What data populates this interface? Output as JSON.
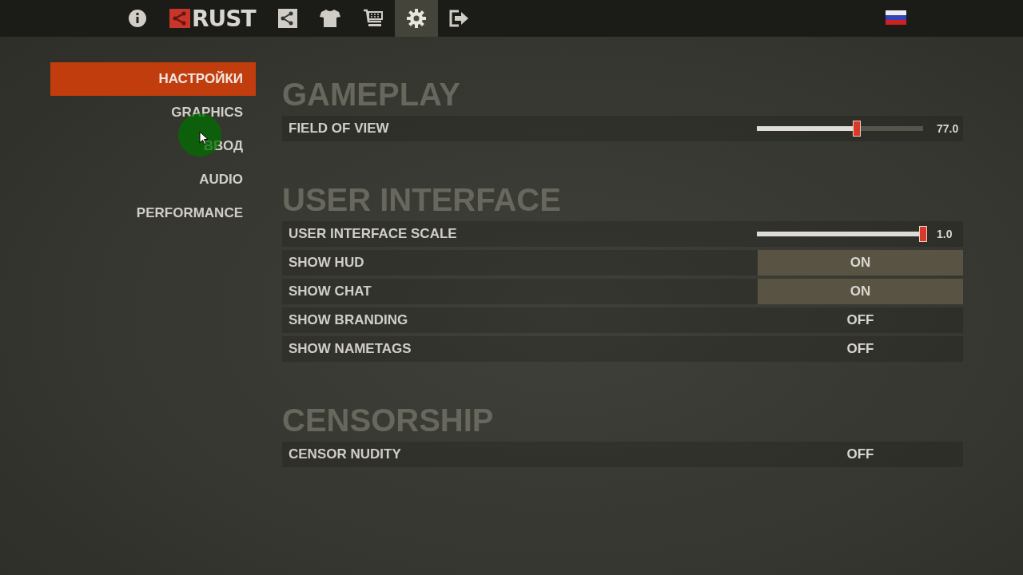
{
  "topbar": {
    "logo": {
      "text": "RUST"
    },
    "tabs": [
      {
        "kind": "info",
        "selected": false
      },
      {
        "kind": "logo",
        "selected": false
      },
      {
        "kind": "nodes",
        "selected": false
      },
      {
        "kind": "shirt",
        "selected": false
      },
      {
        "kind": "cart",
        "selected": false
      },
      {
        "kind": "gear",
        "selected": true
      },
      {
        "kind": "exit",
        "selected": false
      }
    ],
    "language": {
      "kind": "flag-ru"
    }
  },
  "sidebar": {
    "items": [
      {
        "label": "НАСТРОЙКИ",
        "selected": true
      },
      {
        "label": "GRAPHICS",
        "selected": false
      },
      {
        "label": "ВВОД",
        "selected": false
      },
      {
        "label": "AUDIO",
        "selected": false
      },
      {
        "label": "PERFORMANCE",
        "selected": false
      }
    ]
  },
  "sections": [
    {
      "title": "GAMEPLAY",
      "rows": [
        {
          "kind": "slider",
          "label": "FIELD OF VIEW",
          "level": 0.6,
          "reading": "77.0"
        }
      ]
    },
    {
      "title": "USER INTERFACE",
      "rows": [
        {
          "kind": "slider",
          "label": "USER INTERFACE SCALE",
          "level": 1.0,
          "reading": "1.0"
        },
        {
          "kind": "toggle",
          "label": "SHOW HUD",
          "on": true,
          "value": "ON"
        },
        {
          "kind": "toggle",
          "label": "SHOW CHAT",
          "on": true,
          "value": "ON"
        },
        {
          "kind": "toggle",
          "label": "SHOW BRANDING",
          "on": false,
          "value": "OFF"
        },
        {
          "kind": "toggle",
          "label": "SHOW NAMETAGS",
          "on": false,
          "value": "OFF"
        }
      ]
    },
    {
      "title": "CENSORSHIP",
      "rows": [
        {
          "kind": "toggle",
          "label": "CENSOR NUDITY",
          "on": false,
          "value": "OFF"
        }
      ]
    }
  ]
}
